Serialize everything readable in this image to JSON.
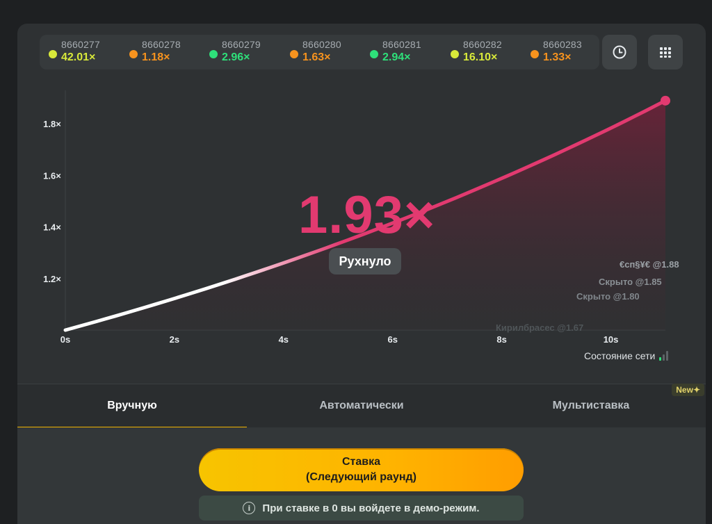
{
  "history": [
    {
      "id": "8660277",
      "value": "42.01×",
      "color": "#d8e93a"
    },
    {
      "id": "8660278",
      "value": "1.18×",
      "color": "#f7931e"
    },
    {
      "id": "8660279",
      "value": "2.96×",
      "color": "#2ee07a"
    },
    {
      "id": "8660280",
      "value": "1.63×",
      "color": "#f7931e"
    },
    {
      "id": "8660281",
      "value": "2.94×",
      "color": "#2ee07a"
    },
    {
      "id": "8660282",
      "value": "16.10×",
      "color": "#d8e93a"
    },
    {
      "id": "8660283",
      "value": "1.33×",
      "color": "#f7931e"
    }
  ],
  "controls": {
    "history_icon": "clock-icon",
    "menu_icon": "grid-icon"
  },
  "chart_data": {
    "type": "line",
    "x_ticks": [
      "0s",
      "2s",
      "4s",
      "6s",
      "8s",
      "10s"
    ],
    "y_ticks": [
      "1.2×",
      "1.4×",
      "1.6×",
      "1.8×"
    ],
    "xlim": [
      0,
      11
    ],
    "ylim": [
      1.0,
      1.93
    ],
    "curve_end": {
      "x": 11.0,
      "y": 1.89
    },
    "line_color": "#e23a70"
  },
  "game": {
    "multiplier": "1.93×",
    "status": "Рухнуло"
  },
  "cashouts": [
    {
      "text": "€сп§¥€ @1.88"
    },
    {
      "text": "Скрыто @1.85"
    },
    {
      "text": "Скрыто @1.80"
    },
    {
      "text": "Кирилбрасес @1.67"
    }
  ],
  "network": {
    "label": "Состояние сети"
  },
  "tabs": [
    {
      "label": "Вручную"
    },
    {
      "label": "Автоматически"
    },
    {
      "label": "Мультиставка"
    }
  ],
  "new_badge": "New✦",
  "bet": {
    "line1": "Ставка",
    "line2": "(Следующий раунд)"
  },
  "info": {
    "text": "При ставке в 0 вы войдете в демо-режим."
  }
}
